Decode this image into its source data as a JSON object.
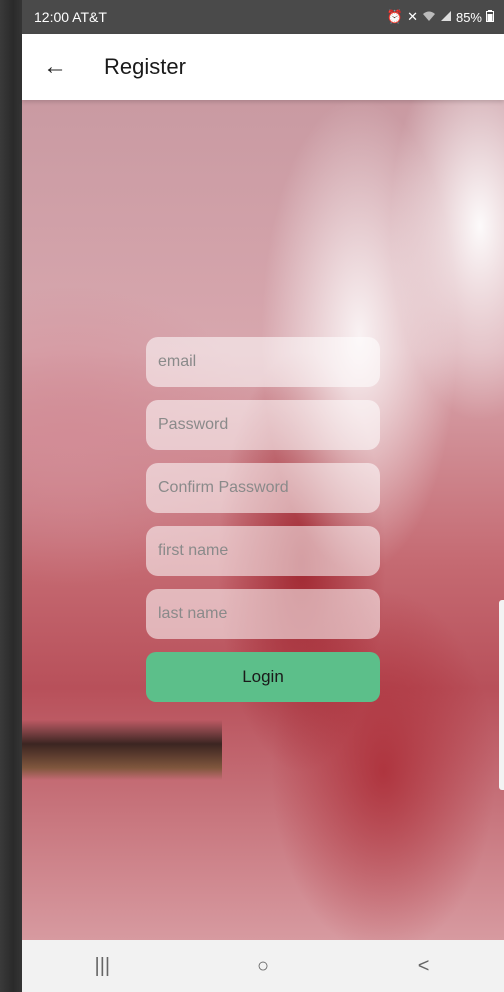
{
  "status_bar": {
    "time_carrier": "12:00 AT&T",
    "battery": "85%",
    "icons": [
      "alarm-icon",
      "mute-icon",
      "wifi-icon",
      "signal-icon",
      "battery-icon"
    ]
  },
  "app_bar": {
    "title": "Register",
    "back_icon": "←"
  },
  "form": {
    "email_placeholder": "email",
    "password_placeholder": "Password",
    "confirm_password_placeholder": "Confirm Password",
    "first_name_placeholder": "first name",
    "last_name_placeholder": "last name",
    "submit_label": "Login"
  },
  "nav_bar": {
    "recents": "|||",
    "home": "○",
    "back": "<"
  },
  "colors": {
    "accent": "#5cbf8a"
  }
}
